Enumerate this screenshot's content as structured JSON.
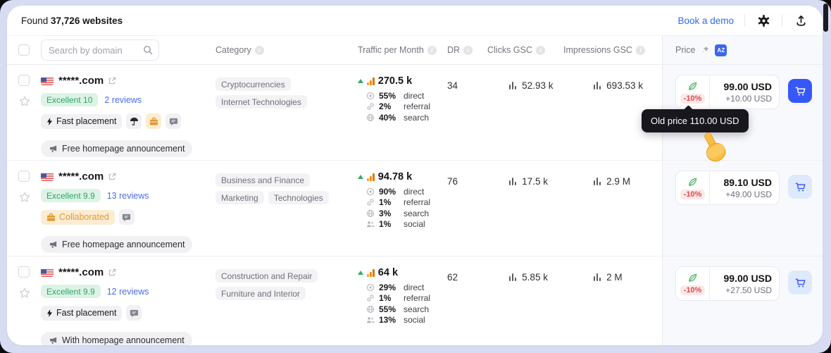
{
  "page": {
    "found_prefix": "Found ",
    "found_bold": "37,726 websites",
    "book_demo": "Book a demo"
  },
  "columns": {
    "search_placeholder": "Search by domain",
    "category": "Category",
    "traffic": "Traffic per Month",
    "dr": "DR",
    "clicks": "Clicks GSC",
    "impressions": "Impressions GSC",
    "price": "Price",
    "sort_badge": "AZ"
  },
  "tooltip": "Old price 110.00 USD",
  "colors": {
    "accent_blue": "#3758f9",
    "link_blue": "#2e6bf0",
    "success_green": "#2fa465",
    "warning_orange": "#df9c34",
    "danger_red": "#e5484d",
    "traffic_orange": "#f18b0a",
    "price_col_bg": "#f8f9fd",
    "page_bg": "#d8dcf3"
  },
  "rows": [
    {
      "domain": "*****.com",
      "rating": "Excellent 10",
      "reviews": "2 reviews",
      "tag": "Fast placement",
      "announcement": "Free homepage announcement",
      "categories": [
        "Cryptocurrencies",
        "Internet Technologies"
      ],
      "traffic_value": "270.5 k",
      "sources": [
        {
          "pct": "55%",
          "label": "direct"
        },
        {
          "pct": "2%",
          "label": "referral"
        },
        {
          "pct": "40%",
          "label": "search"
        }
      ],
      "dr": "34",
      "clicks": "52.93 k",
      "impressions": "693.53 k",
      "discount": "-10%",
      "price": "99.00 USD",
      "extra": "+10.00 USD"
    },
    {
      "domain": "*****.com",
      "rating": "Excellent 9.9",
      "reviews": "13 reviews",
      "tag": "Collaborated",
      "announcement": "Free homepage announcement",
      "categories": [
        "Business and Finance",
        "Marketing",
        "Technologies"
      ],
      "traffic_value": "94.78 k",
      "sources": [
        {
          "pct": "90%",
          "label": "direct"
        },
        {
          "pct": "1%",
          "label": "referral"
        },
        {
          "pct": "3%",
          "label": "search"
        },
        {
          "pct": "1%",
          "label": "social"
        }
      ],
      "dr": "76",
      "clicks": "17.5 k",
      "impressions": "2.9 M",
      "discount": "-10%",
      "price": "89.10 USD",
      "extra": "+49.00 USD"
    },
    {
      "domain": "*****.com",
      "rating": "Excellent 9.9",
      "reviews": "12 reviews",
      "tag": "Fast placement",
      "announcement": "With homepage announcement",
      "categories": [
        "Construction and Repair",
        "Furniture and Interior"
      ],
      "traffic_value": "64 k",
      "sources": [
        {
          "pct": "29%",
          "label": "direct"
        },
        {
          "pct": "1%",
          "label": "referral"
        },
        {
          "pct": "55%",
          "label": "search"
        },
        {
          "pct": "13%",
          "label": "social"
        }
      ],
      "dr": "62",
      "clicks": "5.85 k",
      "impressions": "2 M",
      "discount": "-10%",
      "price": "99.00 USD",
      "extra": "+27.50 USD"
    }
  ]
}
